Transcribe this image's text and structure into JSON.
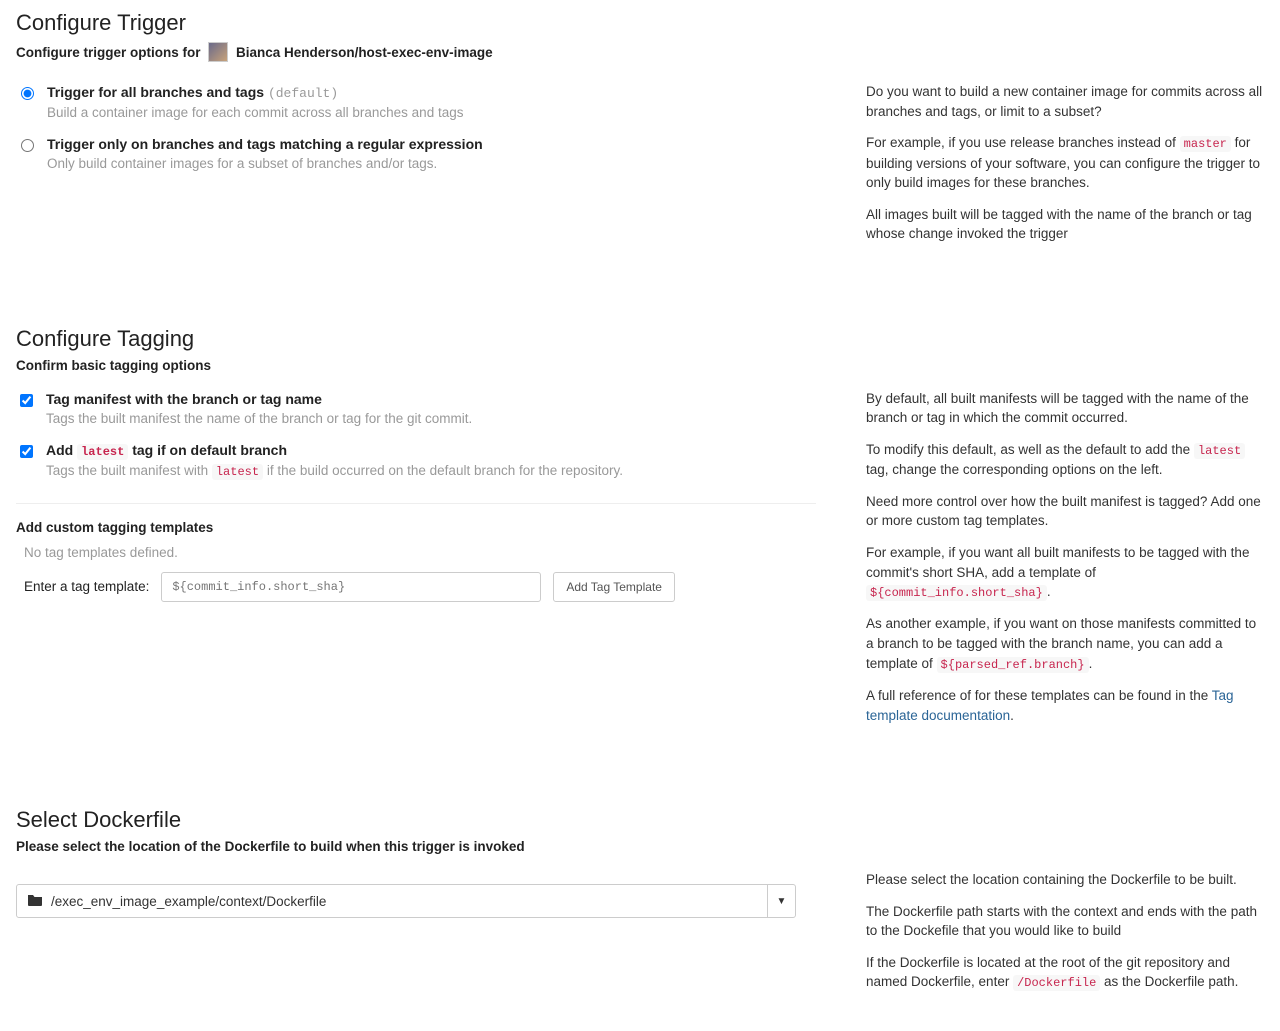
{
  "trigger": {
    "title": "Configure Trigger",
    "sub_prefix": "Configure trigger options for",
    "repo": "Bianca Henderson/host-exec-env-image",
    "opt1": {
      "label": "Trigger for all branches and tags",
      "default_suffix": "(default)",
      "desc": "Build a container image for each commit across all branches and tags"
    },
    "opt2": {
      "label": "Trigger only on branches and tags matching a regular expression",
      "desc": "Only build container images for a subset of branches and/or tags."
    },
    "help": {
      "p1": "Do you want to build a new container image for commits across all branches and tags, or limit to a subset?",
      "p2a": "For example, if you use release branches instead of ",
      "p2_code": "master",
      "p2b": " for building versions of your software, you can configure the trigger to only build images for these branches.",
      "p3": "All images built will be tagged with the name of the branch or tag whose change invoked the trigger"
    }
  },
  "tagging": {
    "title": "Configure Tagging",
    "sub": "Confirm basic tagging options",
    "chk1": {
      "label": "Tag manifest with the branch or tag name",
      "desc": "Tags the built manifest the name of the branch or tag for the git commit."
    },
    "chk2": {
      "label_a": "Add ",
      "label_code": "latest",
      "label_b": " tag if on default branch",
      "desc_a": "Tags the built manifest with ",
      "desc_code": "latest",
      "desc_b": " if the build occurred on the default branch for the repository."
    },
    "custom_title": "Add custom tagging templates",
    "custom_empty": "No tag templates defined.",
    "input_label": "Enter a tag template:",
    "input_placeholder": "${commit_info.short_sha}",
    "add_btn": "Add Tag Template",
    "help": {
      "p1": "By default, all built manifests will be tagged with the name of the branch or tag in which the commit occurred.",
      "p2a": "To modify this default, as well as the default to add the ",
      "p2_code": "latest",
      "p2b": " tag, change the corresponding options on the left.",
      "p3": "Need more control over how the built manifest is tagged? Add one or more custom tag templates.",
      "p4a": "For example, if you want all built manifests to be tagged with the commit's short SHA, add a template of ",
      "p4_code": "${commit_info.short_sha}",
      "p4b": ".",
      "p5a": "As another example, if you want on those manifests committed to a branch to be tagged with the branch name, you can add a template of ",
      "p5_code": "${parsed_ref.branch}",
      "p5b": ".",
      "p6a": "A full reference of for these templates can be found in the ",
      "p6_link": "Tag template documentation",
      "p6b": "."
    }
  },
  "dockerfile": {
    "title": "Select Dockerfile",
    "sub": "Please select the location of the Dockerfile to build when this trigger is invoked",
    "path": "/exec_env_image_example/context/Dockerfile",
    "help": {
      "p1": "Please select the location containing the Dockerfile to be built.",
      "p2": "The Dockerfile path starts with the context and ends with the path to the Dockefile that you would like to build",
      "p3a": "If the Dockerfile is located at the root of the git repository and named Dockerfile, enter ",
      "p3_code": "/Dockerfile",
      "p3b": " as the Dockerfile path."
    }
  }
}
